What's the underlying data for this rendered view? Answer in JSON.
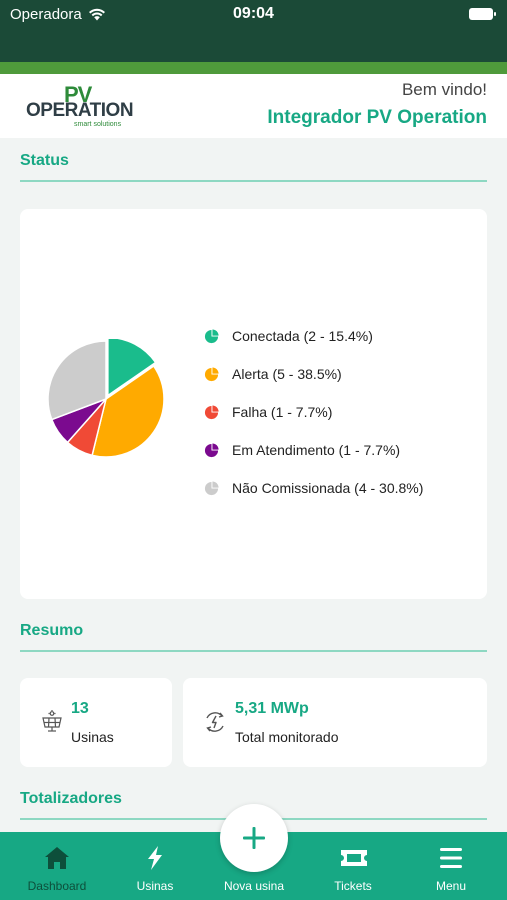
{
  "status_bar": {
    "carrier": "Operadora",
    "time": "09:04"
  },
  "header": {
    "logo_pv": "PV",
    "logo_name": "OPERATION",
    "logo_tagline": "smart solutions",
    "welcome": "Bem vindo!",
    "integrator": "Integrador PV Operation"
  },
  "sections": {
    "status": "Status",
    "resumo": "Resumo",
    "totalizadores": "Totalizadores"
  },
  "status_chart": {
    "legend": [
      {
        "label": "Conectada (2 - 15.4%)",
        "color": "#1abc8c"
      },
      {
        "label": "Alerta (5 - 38.5%)",
        "color": "#ffaa00"
      },
      {
        "label": "Falha (1 - 7.7%)",
        "color": "#f04a36"
      },
      {
        "label": "Em Atendimento (1 - 7.7%)",
        "color": "#7b0a8f"
      },
      {
        "label": "Não Comissionada (4 - 30.8%)",
        "color": "#cccccc"
      }
    ]
  },
  "chart_data": {
    "type": "pie",
    "categories": [
      "Conectada",
      "Alerta",
      "Falha",
      "Em Atendimento",
      "Não Comissionada"
    ],
    "values": [
      2,
      5,
      1,
      1,
      4
    ],
    "percentages": [
      15.4,
      38.5,
      7.7,
      7.7,
      30.8
    ],
    "colors": [
      "#1abc8c",
      "#ffaa00",
      "#f04a36",
      "#7b0a8f",
      "#cccccc"
    ],
    "legend_position": "right"
  },
  "resumo": {
    "usinas": {
      "value": "13",
      "label": "Usinas",
      "icon": "solar-panel-icon"
    },
    "total": {
      "value": "5,31 MWp",
      "label": "Total monitorado",
      "icon": "energy-meter-icon"
    }
  },
  "tabbar": {
    "dashboard": "Dashboard",
    "usinas": "Usinas",
    "nova_usina": "Nova usina",
    "tickets": "Tickets",
    "menu": "Menu"
  },
  "colors": {
    "accent": "#17a884",
    "status_bar": "#1b4a37",
    "brand_green": "#4f9a3b"
  }
}
